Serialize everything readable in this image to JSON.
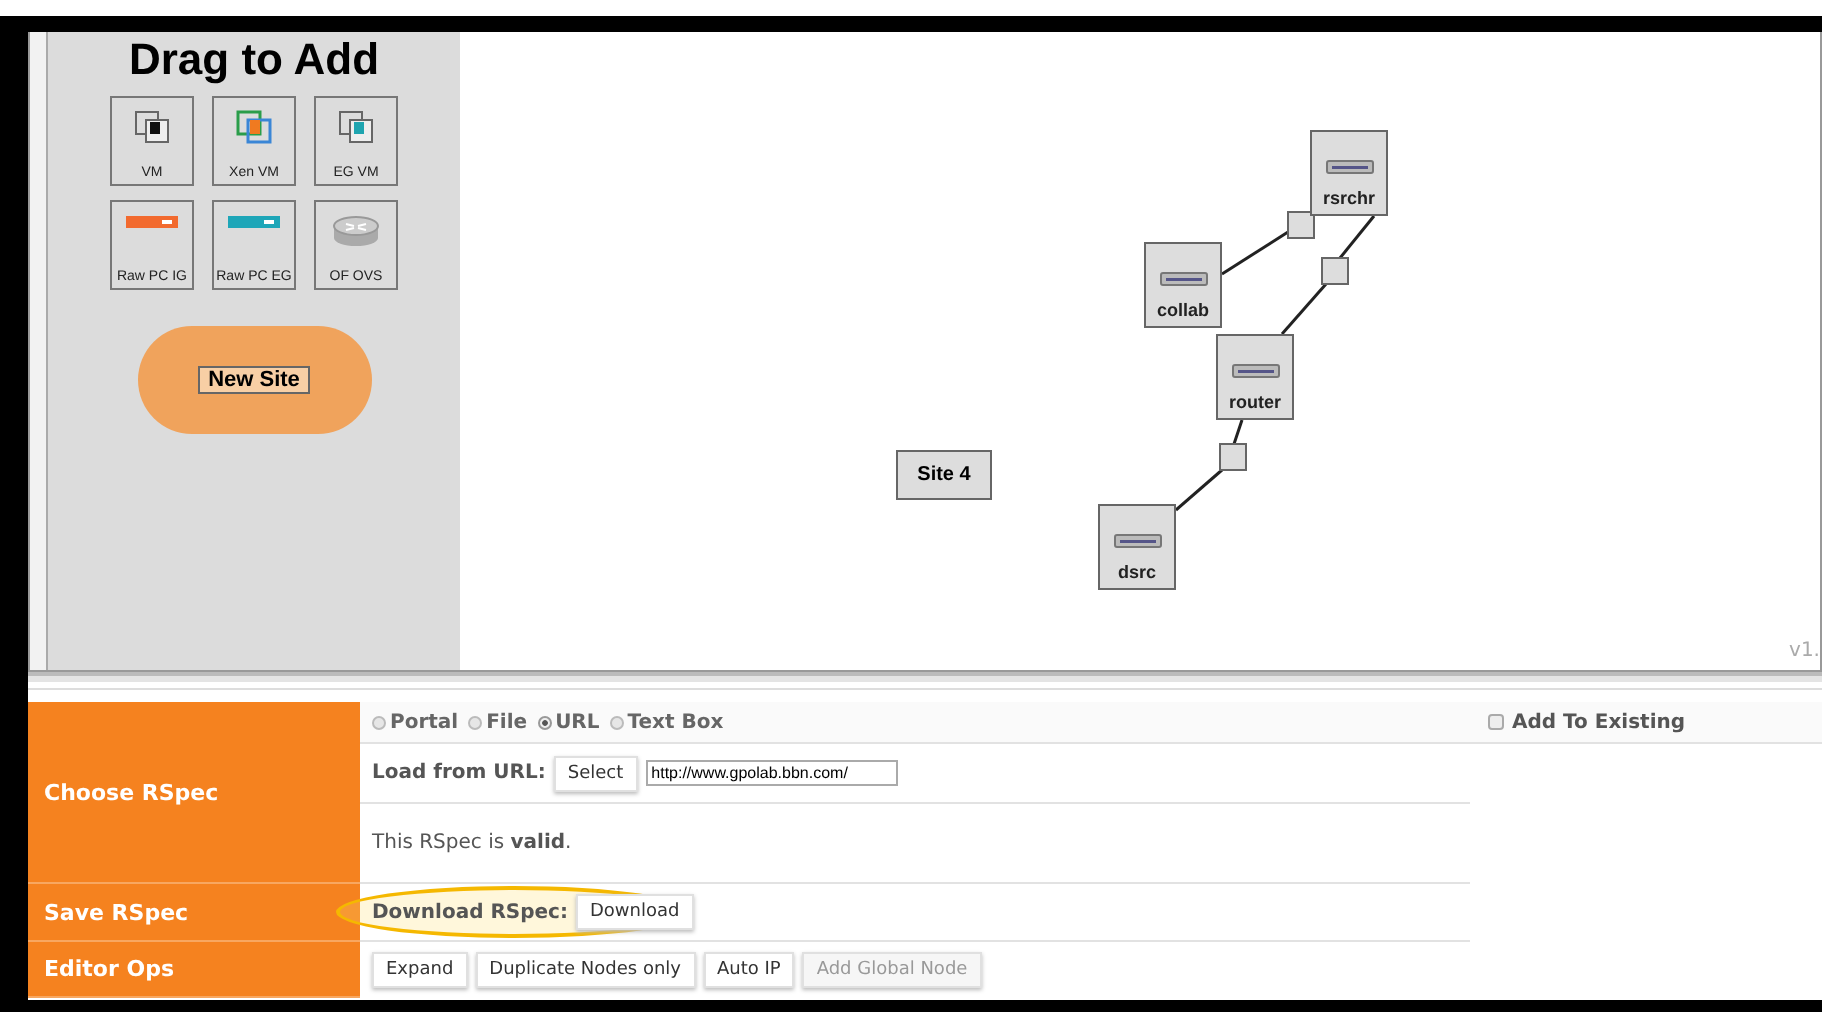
{
  "palette": {
    "title": "Drag to Add",
    "items": [
      {
        "label": "VM",
        "kind": "vm"
      },
      {
        "label": "Xen VM",
        "kind": "xen"
      },
      {
        "label": "EG VM",
        "kind": "egvm"
      },
      {
        "label": "Raw PC IG",
        "kind": "rawig"
      },
      {
        "label": "Raw PC EG",
        "kind": "raweg"
      },
      {
        "label": "OF OVS",
        "kind": "ovs"
      }
    ],
    "new_site": "New Site"
  },
  "canvas": {
    "site": "Site 4",
    "version": "v1.",
    "nodes": [
      {
        "label": "rsrchr"
      },
      {
        "label": "collab"
      },
      {
        "label": "router"
      },
      {
        "label": "dsrc"
      }
    ]
  },
  "choose_rspec": {
    "label": "Choose RSpec",
    "sources": [
      {
        "label": "Portal",
        "selected": false
      },
      {
        "label": "File",
        "selected": false
      },
      {
        "label": "URL",
        "selected": true
      },
      {
        "label": "Text Box",
        "selected": false
      }
    ],
    "load_label": "Load from URL:",
    "select_button": "Select",
    "url": "http://www.gpolab.bbn.com/",
    "status": "This RSpec is **valid**.",
    "add_to_existing": {
      "label": "Add To Existing",
      "checked": false
    }
  },
  "save_rspec": {
    "label": "Save RSpec",
    "download_label": "Download RSpec:",
    "download_button": "Download",
    "highlighted": true
  },
  "editor_ops": {
    "label": "Editor Ops",
    "buttons": [
      {
        "label": "Expand",
        "disabled": false
      },
      {
        "label": "Duplicate Nodes only",
        "disabled": false
      },
      {
        "label": "Auto IP",
        "disabled": false
      },
      {
        "label": "Add Global Node",
        "disabled": true
      }
    ]
  }
}
